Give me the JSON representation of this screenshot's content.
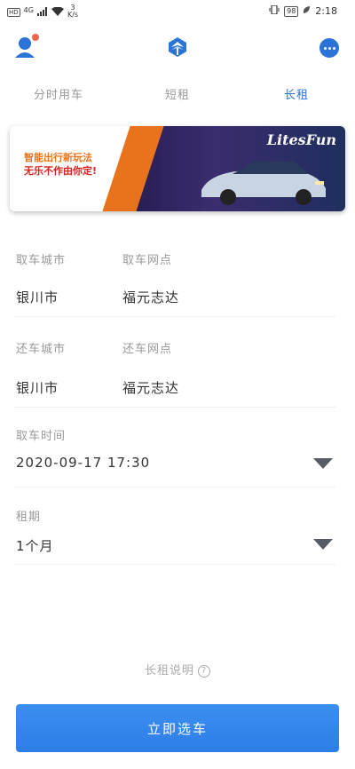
{
  "status_bar": {
    "hd": "HD",
    "signal": "4G",
    "speed_value": "3",
    "speed_unit": "K/s",
    "battery": "98",
    "time": "2:18"
  },
  "nav": {
    "avatar_icon": "user-icon",
    "logo_icon": "brand-logo-icon",
    "more_icon": "more-icon",
    "brand_color": "#2b73d6"
  },
  "tabs": [
    {
      "label": "分时用车",
      "active": false
    },
    {
      "label": "短租",
      "active": false
    },
    {
      "label": "长租",
      "active": true
    }
  ],
  "banner": {
    "line1": "智能出行新玩法",
    "line2": "无乐不作由你定!",
    "brand": "LitesFun"
  },
  "form": {
    "pickup": {
      "city_label": "取车城市",
      "spot_label": "取车网点",
      "city_value": "银川市",
      "spot_value": "福元志达"
    },
    "return": {
      "city_label": "还车城市",
      "spot_label": "还车网点",
      "city_value": "银川市",
      "spot_value": "福元志达"
    },
    "pickup_time": {
      "label": "取车时间",
      "value": "2020-09-17  17:30"
    },
    "rental_period": {
      "label": "租期",
      "value": "1个月"
    }
  },
  "help": {
    "label": "长租说明",
    "icon": "question-icon"
  },
  "submit": {
    "label": "立即选车"
  }
}
